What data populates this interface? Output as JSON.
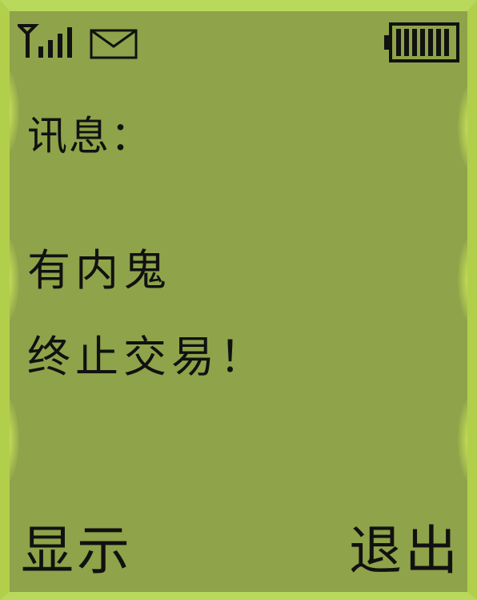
{
  "status_bar": {
    "signal_icon": "signal-bars-icon",
    "message_icon": "envelope-icon",
    "battery_icon": "battery-full-icon"
  },
  "message": {
    "label": "讯息：",
    "lines": [
      "有内鬼",
      "终止交易！"
    ]
  },
  "softkeys": {
    "left": "显示",
    "right": "退出"
  },
  "colors": {
    "screen_bg": "#8fa34a",
    "backlight": "#b9d95d",
    "text": "#111111"
  }
}
